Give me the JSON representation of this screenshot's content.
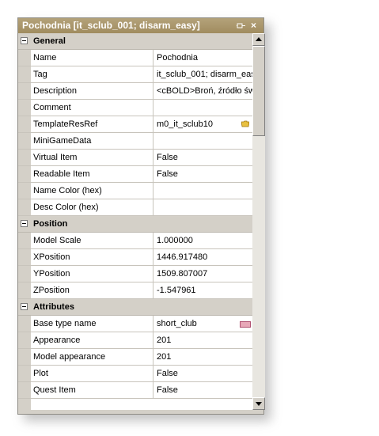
{
  "window": {
    "title": "Pochodnia [it_sclub_001; disarm_easy]",
    "close_glyph": "×",
    "pin_icon": "pin-icon"
  },
  "categories": [
    {
      "label": "General",
      "rows": [
        {
          "name": "Name",
          "value": "Pochodnia"
        },
        {
          "name": "Tag",
          "value": "it_sclub_001; disarm_eas"
        },
        {
          "name": "Description",
          "value": "<cBOLD>Broń, źródło św"
        },
        {
          "name": "Comment",
          "value": ""
        },
        {
          "name": "TemplateResRef",
          "value": "m0_it_sclub10",
          "icon": "folder-browse-icon"
        },
        {
          "name": "MiniGameData",
          "value": ""
        },
        {
          "name": "Virtual Item",
          "value": "False"
        },
        {
          "name": "Readable Item",
          "value": "False"
        },
        {
          "name": "Name Color (hex)",
          "value": ""
        },
        {
          "name": "Desc Color (hex)",
          "value": ""
        }
      ]
    },
    {
      "label": "Position",
      "rows": [
        {
          "name": "Model Scale",
          "value": "1.000000"
        },
        {
          "name": "XPosition",
          "value": "1446.917480"
        },
        {
          "name": "YPosition",
          "value": "1509.807007"
        },
        {
          "name": "ZPosition",
          "value": "-1.547961"
        }
      ]
    },
    {
      "label": "Attributes",
      "rows": [
        {
          "name": "Base type name",
          "value": "short_club",
          "icon": "resource-icon"
        },
        {
          "name": "Appearance",
          "value": "201"
        },
        {
          "name": "Model appearance",
          "value": "201"
        },
        {
          "name": "Plot",
          "value": "False"
        },
        {
          "name": "Quest Item",
          "value": "False"
        }
      ]
    }
  ]
}
